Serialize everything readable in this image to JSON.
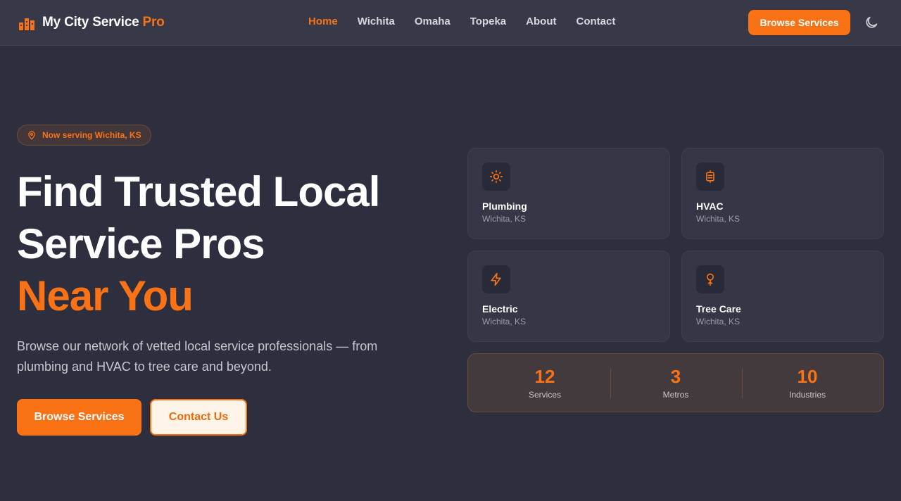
{
  "header": {
    "brand_name": "My City Service",
    "brand_accent": "Pro",
    "nav": [
      {
        "label": "Home",
        "active": true
      },
      {
        "label": "Wichita"
      },
      {
        "label": "Omaha"
      },
      {
        "label": "Topeka"
      },
      {
        "label": "About"
      },
      {
        "label": "Contact"
      }
    ],
    "cta_label": "Browse Services",
    "theme_icon": "moon-icon"
  },
  "hero": {
    "badge_icon": "map-pin-icon",
    "badge_text": "Now serving Wichita, KS",
    "title_line1": "Find Trusted Local",
    "title_line2": "Service Pros",
    "title_accent": "Near You",
    "description": "Browse our network of vetted local service professionals — from plumbing and HVAC to tree care and beyond.",
    "primary_button": "Browse Services",
    "secondary_button": "Contact Us"
  },
  "services": [
    {
      "title": "Plumbing",
      "location": "Wichita, KS",
      "icon": "sun-icon"
    },
    {
      "title": "HVAC",
      "location": "Wichita, KS",
      "icon": "hvac-unit-icon"
    },
    {
      "title": "Electric",
      "location": "Wichita, KS",
      "icon": "lightning-bolt-icon"
    },
    {
      "title": "Tree Care",
      "location": "Wichita, KS",
      "icon": "tree-icon"
    }
  ],
  "stats": [
    {
      "value": "12",
      "label": "Services"
    },
    {
      "value": "3",
      "label": "Metros"
    },
    {
      "value": "10",
      "label": "Industries"
    }
  ],
  "colors": {
    "accent": "#f97316",
    "background": "#2e2f3e",
    "header_background": "#383948",
    "card_background": "#353646"
  }
}
